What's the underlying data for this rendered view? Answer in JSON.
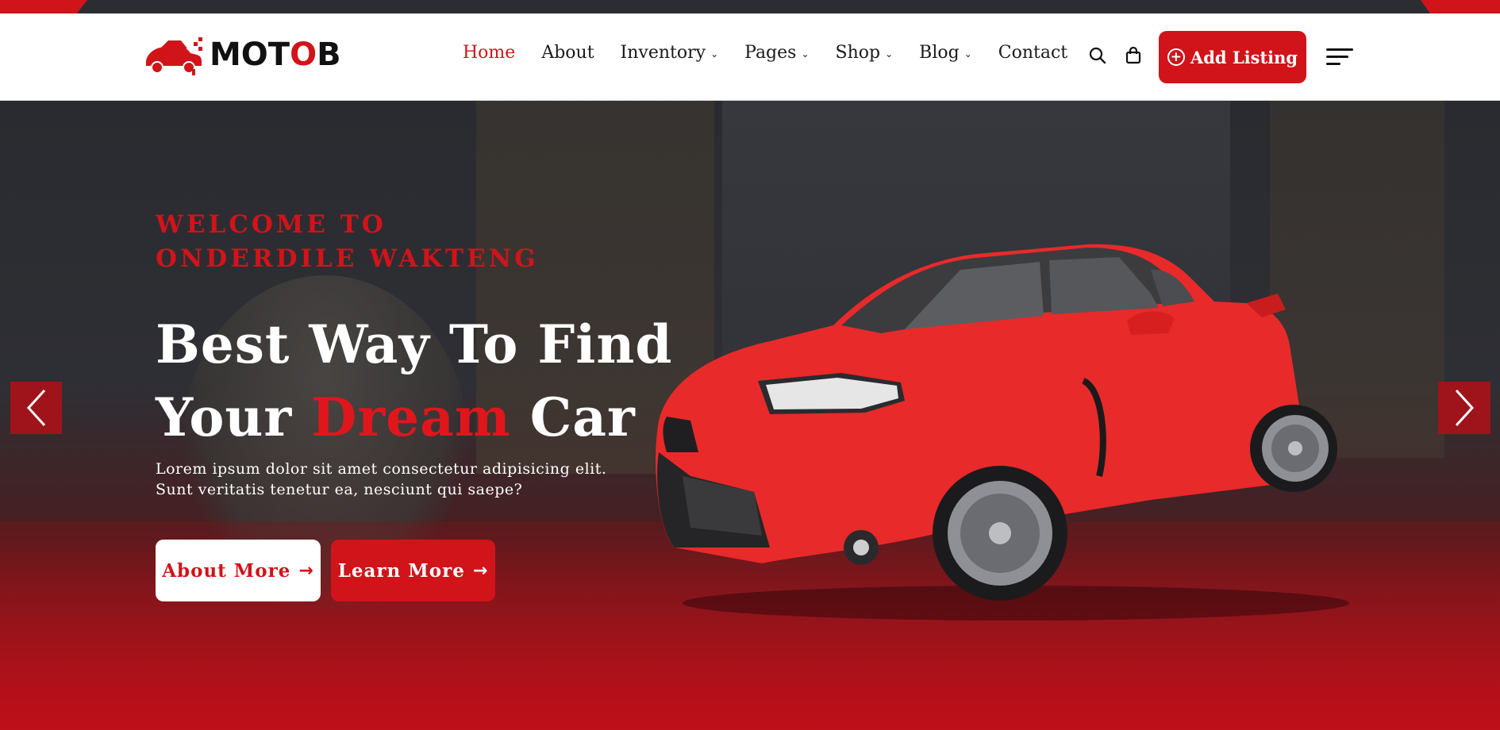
{
  "brand": {
    "name_part1": "MOT",
    "name_o": "O",
    "name_part2": "B",
    "accent_color": "#d0141a"
  },
  "nav": {
    "items": [
      {
        "label": "Home",
        "active": true,
        "dropdown": false
      },
      {
        "label": "About",
        "active": false,
        "dropdown": false
      },
      {
        "label": "Inventory",
        "active": false,
        "dropdown": true
      },
      {
        "label": "Pages",
        "active": false,
        "dropdown": true
      },
      {
        "label": "Shop",
        "active": false,
        "dropdown": true
      },
      {
        "label": "Blog",
        "active": false,
        "dropdown": true
      },
      {
        "label": "Contact",
        "active": false,
        "dropdown": false
      }
    ],
    "chevron": "⌄",
    "search_icon": "search-icon",
    "cart_icon": "shopping-bag-icon",
    "add_listing_label": "Add Listing",
    "add_listing_icon": "plus-circle-icon",
    "menu_icon": "hamburger-menu-icon"
  },
  "hero": {
    "subtitle_line1": "WELCOME TO",
    "subtitle_line2": "ONDERDILE WAKTENG",
    "title_line1": "Best Way To Find",
    "title_line2_start": "Your ",
    "title_line2_highlight": "Dream",
    "title_line2_end": " Car",
    "desc_line1": "Lorem ipsum dolor sit amet consectetur adipisicing elit.",
    "desc_line2": "Sunt veritatis tenetur ea, nesciunt qui saepe?",
    "btn_about": "About More",
    "btn_learn": "Learn More",
    "btn_arrow": "→",
    "prev_icon": "chevron-left-icon",
    "next_icon": "chevron-right-icon"
  }
}
